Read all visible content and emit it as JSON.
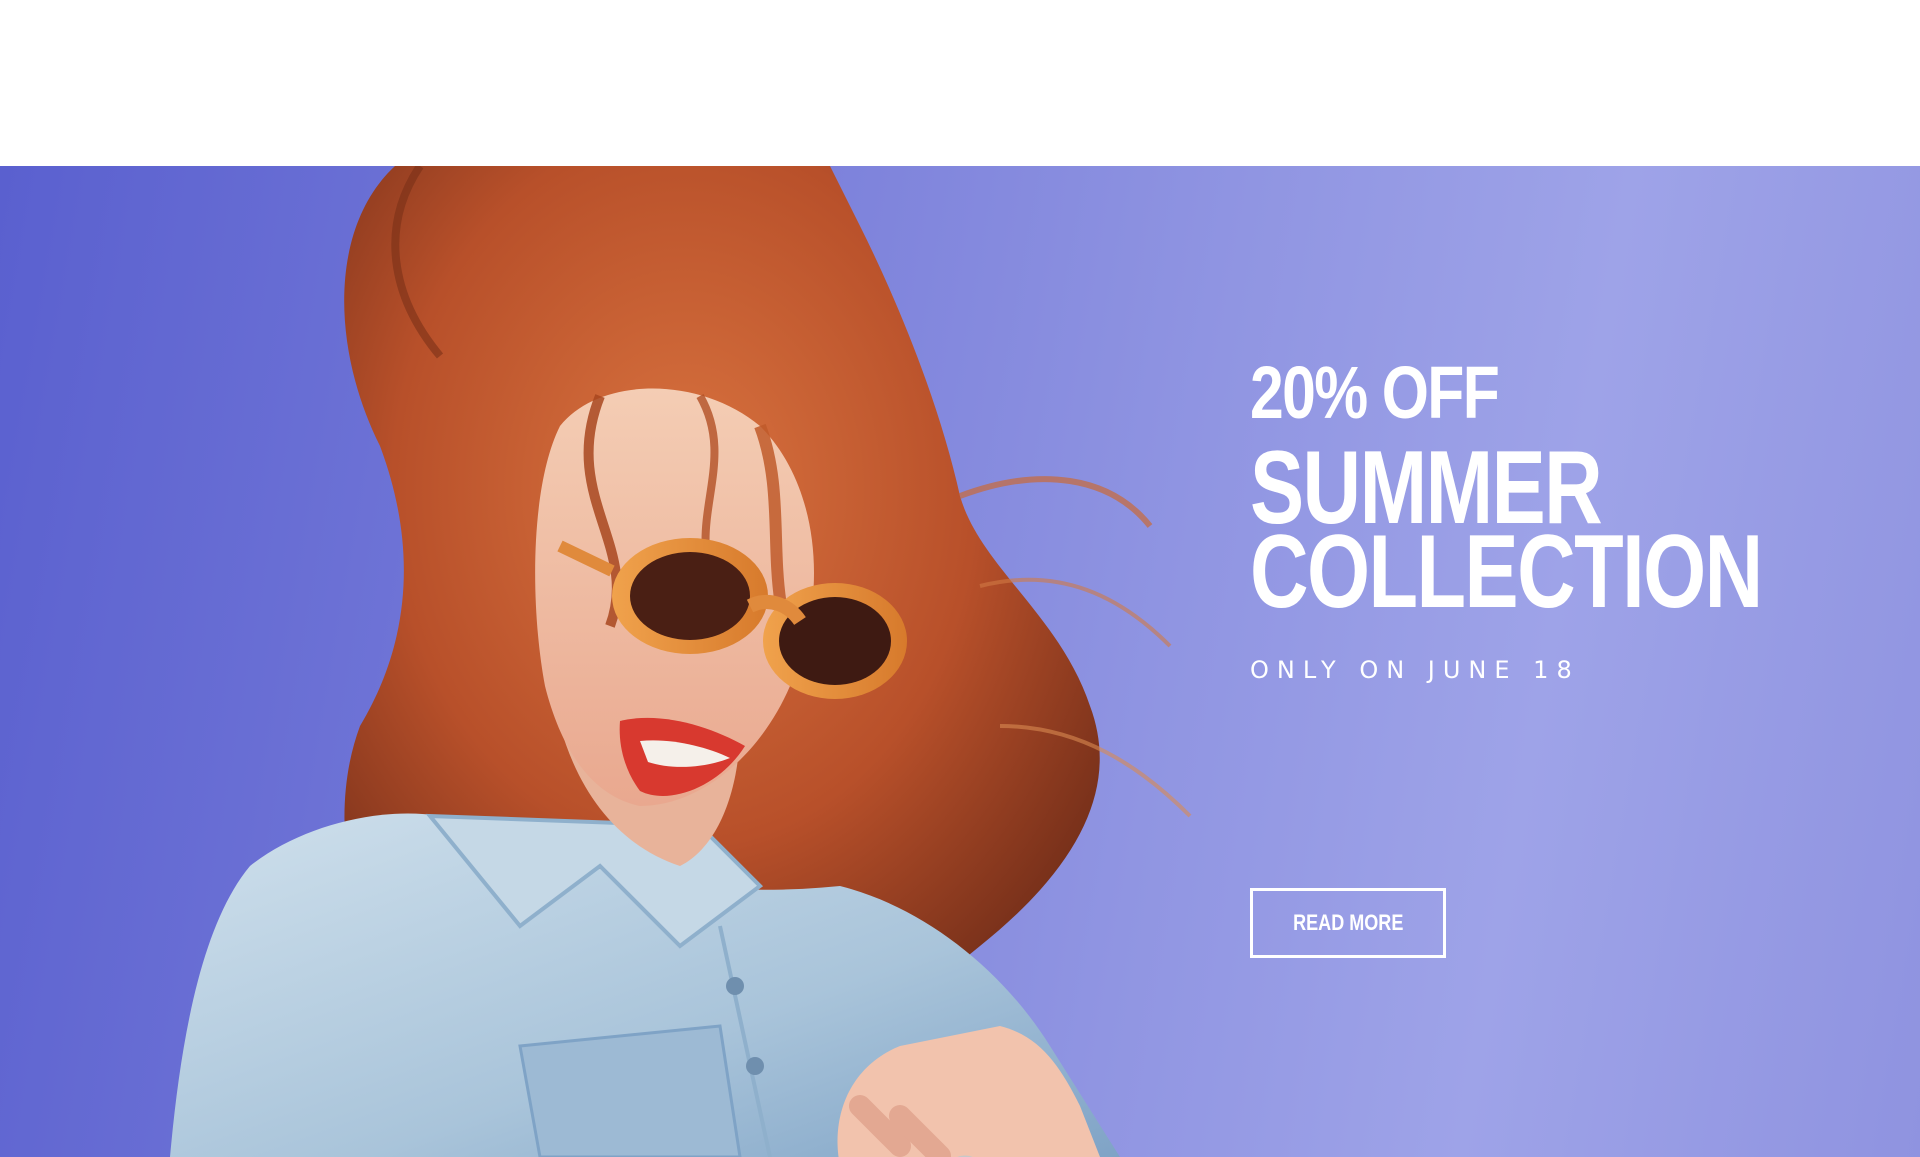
{
  "hero": {
    "discount": "20% OFF",
    "title_line1": "SUMMER",
    "title_line2": "COLLECTION",
    "date": "ONLY ON JUNE 18",
    "button_label": "READ MORE",
    "colors": {
      "background": "#8f93e0",
      "text": "#ffffff"
    }
  }
}
